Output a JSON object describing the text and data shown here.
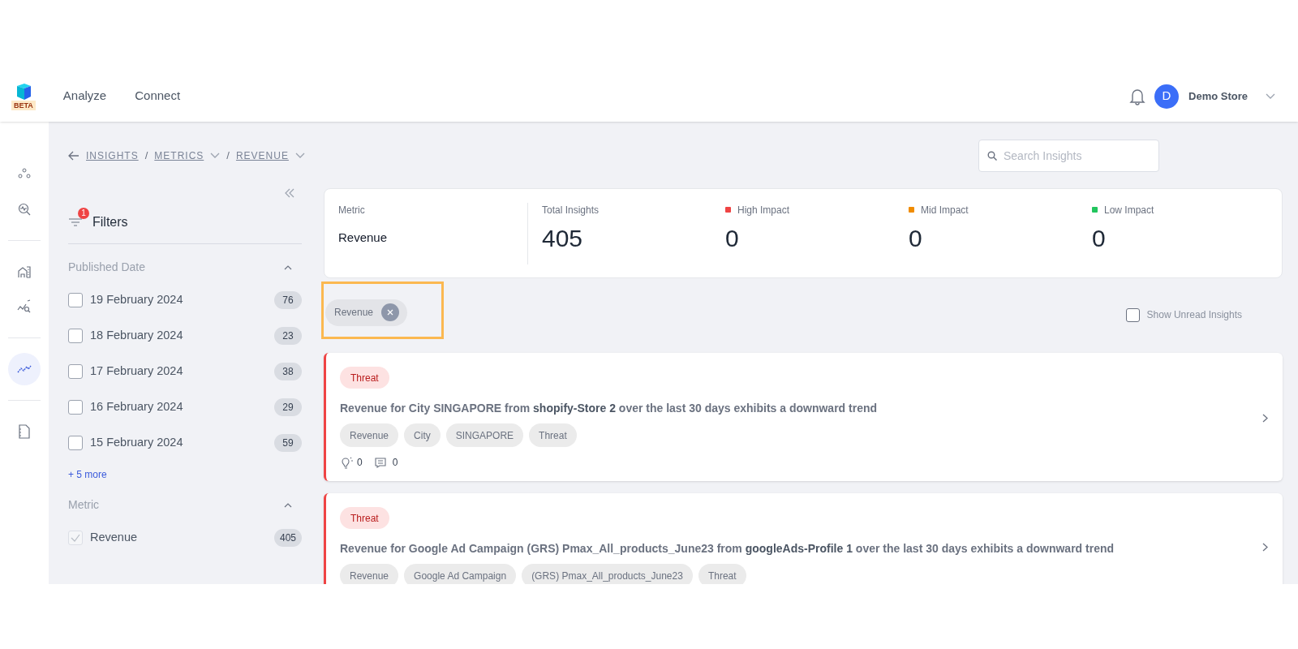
{
  "header": {
    "logo_badge": "BETA",
    "nav": [
      {
        "label": "Analyze"
      },
      {
        "label": "Connect"
      }
    ],
    "user": {
      "avatar_letter": "D",
      "name": "Demo Store"
    }
  },
  "rail": {
    "groups": [
      {
        "items": [
          {
            "kind": "nodes",
            "selected": false
          },
          {
            "kind": "search",
            "selected": false
          }
        ]
      },
      {
        "items": [
          {
            "kind": "building",
            "selected": false
          },
          {
            "kind": "chart-search",
            "selected": false
          }
        ]
      },
      {
        "items": [
          {
            "kind": "trend",
            "selected": true
          }
        ]
      },
      {
        "items": [
          {
            "kind": "document",
            "selected": false
          }
        ]
      }
    ]
  },
  "breadcrumb": {
    "separator": "/",
    "items": [
      {
        "label": "INSIGHTS",
        "dropdown": false
      },
      {
        "label": "METRICS",
        "dropdown": true
      },
      {
        "label": "REVENUE",
        "dropdown": true
      }
    ]
  },
  "search": {
    "placeholder": "Search Insights"
  },
  "filters": {
    "title": "Filters",
    "badge": "1",
    "sections": [
      {
        "title": "Published Date",
        "expanded": true,
        "more": "+ 5 more",
        "options": [
          {
            "label": "19 February 2024",
            "count": "76",
            "checked": false,
            "disabled": false
          },
          {
            "label": "18 February 2024",
            "count": "23",
            "checked": false,
            "disabled": false
          },
          {
            "label": "17 February 2024",
            "count": "38",
            "checked": false,
            "disabled": false
          },
          {
            "label": "16 February 2024",
            "count": "29",
            "checked": false,
            "disabled": false
          },
          {
            "label": "15 February 2024",
            "count": "59",
            "checked": false,
            "disabled": false
          }
        ]
      },
      {
        "title": "Metric",
        "expanded": true,
        "options": [
          {
            "label": "Revenue",
            "count": "405",
            "checked": true,
            "disabled": true
          }
        ]
      }
    ]
  },
  "summary": [
    {
      "kind": "text",
      "label": "Metric",
      "value": "Revenue"
    },
    {
      "kind": "number",
      "label": "Total Insights",
      "value": "405"
    },
    {
      "kind": "number",
      "label": "High Impact",
      "value": "0",
      "color": "#ef4444"
    },
    {
      "kind": "number",
      "label": "Mid Impact",
      "value": "0",
      "color": "#f08c00"
    },
    {
      "kind": "number",
      "label": "Low Impact",
      "value": "0",
      "color": "#22c55e"
    }
  ],
  "active_filters": [
    {
      "label": "Revenue"
    }
  ],
  "show_unread": {
    "label": "Show Unread Insights",
    "checked": false
  },
  "insights": [
    {
      "tag": "Threat",
      "title": "Revenue for City SINGAPORE from **shopify-Store 2** over the last 30 days exhibits a downward trend",
      "chips": [
        "Revenue",
        "City",
        "SINGAPORE",
        "Threat"
      ],
      "ideas": "0",
      "comments": "0"
    },
    {
      "tag": "Threat",
      "title": "Revenue for Google Ad Campaign (GRS) Pmax_All_products_June23 from **googleAds-Profile 1** over the last 30 days exhibits a downward trend",
      "chips": [
        "Revenue",
        "Google Ad Campaign",
        "(GRS) Pmax_All_products_June23",
        "Threat"
      ]
    }
  ]
}
